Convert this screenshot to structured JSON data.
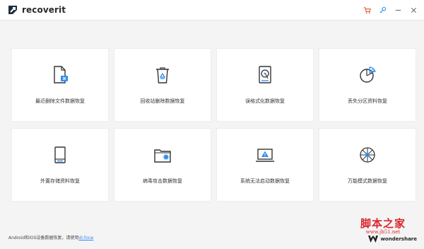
{
  "app": {
    "name": "recoverit"
  },
  "toolbar": {
    "icons": [
      "cart-icon",
      "key-icon",
      "minimize-icon",
      "close-icon"
    ]
  },
  "cards": [
    {
      "label": "最近删除文件数据恢复",
      "icon": "deleted-file-icon"
    },
    {
      "label": "回收站删除数据恢复",
      "icon": "recycle-bin-icon"
    },
    {
      "label": "误格式化数据恢复",
      "icon": "hard-drive-icon"
    },
    {
      "label": "丢失分区资料恢复",
      "icon": "partition-icon"
    },
    {
      "label": "外置存储资料恢复",
      "icon": "external-storage-icon"
    },
    {
      "label": "病毒攻击数据恢复",
      "icon": "virus-folder-icon"
    },
    {
      "label": "系统无法启动数据恢复",
      "icon": "laptop-warning-icon"
    },
    {
      "label": "万能模式数据恢复",
      "icon": "all-round-icon"
    }
  ],
  "footer": {
    "text": "Android和iOS设备数据恢复，请使用",
    "link": "dr.fone"
  },
  "brand": {
    "name": "wondershare"
  },
  "watermark": {
    "title": "脚本之家",
    "url": "www.jb51.net"
  },
  "colors": {
    "accent": "#2d8cf0",
    "topbar_icon": "#e0523f",
    "watermark": "#d9262f"
  }
}
